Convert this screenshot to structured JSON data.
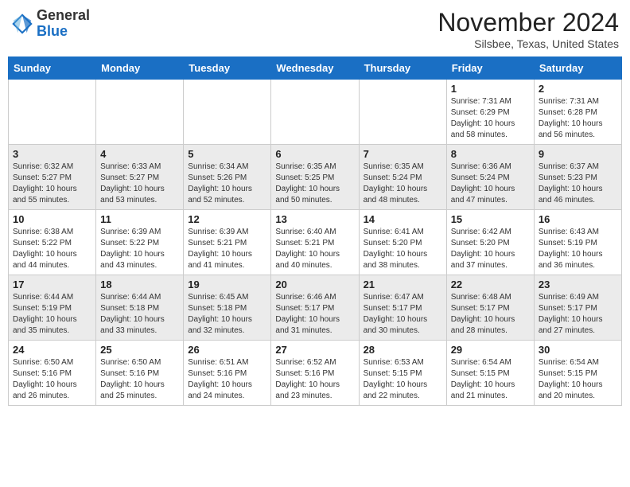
{
  "header": {
    "logo_general": "General",
    "logo_blue": "Blue",
    "month_year": "November 2024",
    "location": "Silsbee, Texas, United States"
  },
  "weekdays": [
    "Sunday",
    "Monday",
    "Tuesday",
    "Wednesday",
    "Thursday",
    "Friday",
    "Saturday"
  ],
  "weeks": [
    [
      {
        "day": "",
        "info": ""
      },
      {
        "day": "",
        "info": ""
      },
      {
        "day": "",
        "info": ""
      },
      {
        "day": "",
        "info": ""
      },
      {
        "day": "",
        "info": ""
      },
      {
        "day": "1",
        "info": "Sunrise: 7:31 AM\nSunset: 6:29 PM\nDaylight: 10 hours\nand 58 minutes."
      },
      {
        "day": "2",
        "info": "Sunrise: 7:31 AM\nSunset: 6:28 PM\nDaylight: 10 hours\nand 56 minutes."
      }
    ],
    [
      {
        "day": "3",
        "info": "Sunrise: 6:32 AM\nSunset: 5:27 PM\nDaylight: 10 hours\nand 55 minutes."
      },
      {
        "day": "4",
        "info": "Sunrise: 6:33 AM\nSunset: 5:27 PM\nDaylight: 10 hours\nand 53 minutes."
      },
      {
        "day": "5",
        "info": "Sunrise: 6:34 AM\nSunset: 5:26 PM\nDaylight: 10 hours\nand 52 minutes."
      },
      {
        "day": "6",
        "info": "Sunrise: 6:35 AM\nSunset: 5:25 PM\nDaylight: 10 hours\nand 50 minutes."
      },
      {
        "day": "7",
        "info": "Sunrise: 6:35 AM\nSunset: 5:24 PM\nDaylight: 10 hours\nand 48 minutes."
      },
      {
        "day": "8",
        "info": "Sunrise: 6:36 AM\nSunset: 5:24 PM\nDaylight: 10 hours\nand 47 minutes."
      },
      {
        "day": "9",
        "info": "Sunrise: 6:37 AM\nSunset: 5:23 PM\nDaylight: 10 hours\nand 46 minutes."
      }
    ],
    [
      {
        "day": "10",
        "info": "Sunrise: 6:38 AM\nSunset: 5:22 PM\nDaylight: 10 hours\nand 44 minutes."
      },
      {
        "day": "11",
        "info": "Sunrise: 6:39 AM\nSunset: 5:22 PM\nDaylight: 10 hours\nand 43 minutes."
      },
      {
        "day": "12",
        "info": "Sunrise: 6:39 AM\nSunset: 5:21 PM\nDaylight: 10 hours\nand 41 minutes."
      },
      {
        "day": "13",
        "info": "Sunrise: 6:40 AM\nSunset: 5:21 PM\nDaylight: 10 hours\nand 40 minutes."
      },
      {
        "day": "14",
        "info": "Sunrise: 6:41 AM\nSunset: 5:20 PM\nDaylight: 10 hours\nand 38 minutes."
      },
      {
        "day": "15",
        "info": "Sunrise: 6:42 AM\nSunset: 5:20 PM\nDaylight: 10 hours\nand 37 minutes."
      },
      {
        "day": "16",
        "info": "Sunrise: 6:43 AM\nSunset: 5:19 PM\nDaylight: 10 hours\nand 36 minutes."
      }
    ],
    [
      {
        "day": "17",
        "info": "Sunrise: 6:44 AM\nSunset: 5:19 PM\nDaylight: 10 hours\nand 35 minutes."
      },
      {
        "day": "18",
        "info": "Sunrise: 6:44 AM\nSunset: 5:18 PM\nDaylight: 10 hours\nand 33 minutes."
      },
      {
        "day": "19",
        "info": "Sunrise: 6:45 AM\nSunset: 5:18 PM\nDaylight: 10 hours\nand 32 minutes."
      },
      {
        "day": "20",
        "info": "Sunrise: 6:46 AM\nSunset: 5:17 PM\nDaylight: 10 hours\nand 31 minutes."
      },
      {
        "day": "21",
        "info": "Sunrise: 6:47 AM\nSunset: 5:17 PM\nDaylight: 10 hours\nand 30 minutes."
      },
      {
        "day": "22",
        "info": "Sunrise: 6:48 AM\nSunset: 5:17 PM\nDaylight: 10 hours\nand 28 minutes."
      },
      {
        "day": "23",
        "info": "Sunrise: 6:49 AM\nSunset: 5:17 PM\nDaylight: 10 hours\nand 27 minutes."
      }
    ],
    [
      {
        "day": "24",
        "info": "Sunrise: 6:50 AM\nSunset: 5:16 PM\nDaylight: 10 hours\nand 26 minutes."
      },
      {
        "day": "25",
        "info": "Sunrise: 6:50 AM\nSunset: 5:16 PM\nDaylight: 10 hours\nand 25 minutes."
      },
      {
        "day": "26",
        "info": "Sunrise: 6:51 AM\nSunset: 5:16 PM\nDaylight: 10 hours\nand 24 minutes."
      },
      {
        "day": "27",
        "info": "Sunrise: 6:52 AM\nSunset: 5:16 PM\nDaylight: 10 hours\nand 23 minutes."
      },
      {
        "day": "28",
        "info": "Sunrise: 6:53 AM\nSunset: 5:15 PM\nDaylight: 10 hours\nand 22 minutes."
      },
      {
        "day": "29",
        "info": "Sunrise: 6:54 AM\nSunset: 5:15 PM\nDaylight: 10 hours\nand 21 minutes."
      },
      {
        "day": "30",
        "info": "Sunrise: 6:54 AM\nSunset: 5:15 PM\nDaylight: 10 hours\nand 20 minutes."
      }
    ]
  ]
}
